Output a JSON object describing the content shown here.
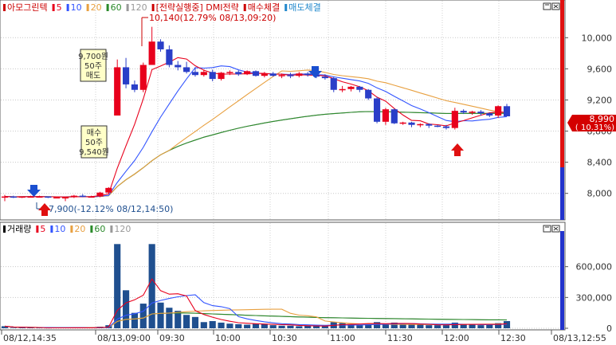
{
  "price_panel": {
    "legend": [
      {
        "text": "아모그린텍",
        "color": "#cc0000"
      },
      {
        "text": "5",
        "color": "#e8001c"
      },
      {
        "text": "10",
        "color": "#3355ff"
      },
      {
        "text": "20",
        "color": "#e8a040"
      },
      {
        "text": "60",
        "color": "#2a8a2a"
      },
      {
        "text": "120",
        "color": "#999999"
      },
      {
        "text": "[전략실행중] DMI전략",
        "color": "#cc0000"
      },
      {
        "text": "매수체결",
        "color": "#cc0000"
      },
      {
        "text": "매도체결",
        "color": "#2288cc"
      }
    ],
    "high_label": "10,140(12.79% 08/13,09:20)",
    "low_label": "7,900(-12.12% 08/12,14:50)",
    "current_price": "8,990",
    "current_change": "( 10.31%)",
    "sell_box": {
      "price": "9,700원",
      "qty": "50주",
      "side": "매도"
    },
    "buy_box": {
      "side": "매수",
      "qty": "50주",
      "price": "9,540원"
    }
  },
  "volume_panel": {
    "legend": [
      {
        "text": "거래량",
        "color": "#000000"
      },
      {
        "text": "5",
        "color": "#e8001c"
      },
      {
        "text": "10",
        "color": "#3355ff"
      },
      {
        "text": "20",
        "color": "#e8a040"
      },
      {
        "text": "60",
        "color": "#2a8a2a"
      },
      {
        "text": "120",
        "color": "#999999"
      }
    ]
  },
  "colors": {
    "up": "#e8001c",
    "down": "#2a3ec8",
    "bar": "#1f4f8f",
    "accent": "#cc0000"
  },
  "chart_data": {
    "type": "candlestick",
    "price_axis": {
      "ticks": [
        8000,
        8400,
        8800,
        9200,
        9600,
        10000
      ],
      "tick_labels": [
        "8,000",
        "8,400",
        "8,800",
        "9,200",
        "9,600",
        "10,000"
      ],
      "range": [
        7700,
        10300
      ]
    },
    "volume_axis": {
      "ticks": [
        0,
        300000,
        600000
      ],
      "tick_labels": [
        "0",
        "300,000",
        "600,000"
      ],
      "range": [
        0,
        900000
      ]
    },
    "x_tick_labels": [
      "08/12,14:35",
      "08/13,09:00",
      "09:30",
      "10:00",
      "10:30",
      "11:00",
      "11:30",
      "12:00",
      "12:30",
      "08/13,12:55"
    ],
    "candles": [
      [
        7960,
        7980,
        7900,
        7960
      ],
      [
        7960,
        7970,
        7940,
        7950
      ],
      [
        7950,
        7960,
        7940,
        7960
      ],
      [
        7960,
        7970,
        7950,
        7960
      ],
      [
        7960,
        7970,
        7950,
        7960
      ],
      [
        7960,
        7960,
        7940,
        7950
      ],
      [
        7950,
        7960,
        7940,
        7950
      ],
      [
        7950,
        7960,
        7900,
        7950
      ],
      [
        7950,
        7980,
        7940,
        7970
      ],
      [
        7970,
        7990,
        7950,
        7960
      ],
      [
        7960,
        7970,
        7950,
        7960
      ],
      [
        7960,
        8020,
        7950,
        8010
      ],
      [
        8010,
        8080,
        8000,
        8070
      ],
      [
        9000,
        9720,
        9000,
        9620
      ],
      [
        9620,
        9740,
        9350,
        9400
      ],
      [
        9400,
        9450,
        9300,
        9330
      ],
      [
        9330,
        9680,
        9300,
        9650
      ],
      [
        9650,
        10140,
        9650,
        9950
      ],
      [
        9950,
        9980,
        9820,
        9850
      ],
      [
        9850,
        9900,
        9620,
        9650
      ],
      [
        9650,
        9700,
        9580,
        9620
      ],
      [
        9620,
        9690,
        9540,
        9560
      ],
      [
        9560,
        9620,
        9500,
        9520
      ],
      [
        9520,
        9590,
        9500,
        9560
      ],
      [
        9560,
        9590,
        9440,
        9470
      ],
      [
        9470,
        9560,
        9450,
        9550
      ],
      [
        9550,
        9580,
        9520,
        9560
      ],
      [
        9560,
        9580,
        9510,
        9530
      ],
      [
        9530,
        9580,
        9520,
        9570
      ],
      [
        9570,
        9580,
        9500,
        9510
      ],
      [
        9510,
        9560,
        9490,
        9540
      ],
      [
        9540,
        9560,
        9500,
        9510
      ],
      [
        9510,
        9540,
        9480,
        9520
      ],
      [
        9520,
        9550,
        9480,
        9510
      ],
      [
        9510,
        9560,
        9490,
        9540
      ],
      [
        9540,
        9560,
        9500,
        9520
      ],
      [
        9520,
        9540,
        9480,
        9500
      ],
      [
        9500,
        9530,
        9460,
        9480
      ],
      [
        9480,
        9500,
        9300,
        9330
      ],
      [
        9330,
        9380,
        9300,
        9340
      ],
      [
        9340,
        9380,
        9310,
        9370
      ],
      [
        9370,
        9380,
        9300,
        9330
      ],
      [
        9330,
        9340,
        9200,
        9220
      ],
      [
        9220,
        9240,
        8900,
        8920
      ],
      [
        8920,
        9100,
        8880,
        9080
      ],
      [
        9080,
        9090,
        8890,
        8900
      ],
      [
        8900,
        8920,
        8880,
        8910
      ],
      [
        8910,
        8920,
        8850,
        8880
      ],
      [
        8880,
        8900,
        8850,
        8890
      ],
      [
        8890,
        8900,
        8840,
        8870
      ],
      [
        8870,
        8880,
        8850,
        8860
      ],
      [
        8860,
        8880,
        8820,
        8840
      ],
      [
        8840,
        9100,
        8820,
        9060
      ],
      [
        9060,
        9080,
        9020,
        9040
      ],
      [
        9040,
        9060,
        9010,
        9050
      ],
      [
        9050,
        9070,
        9000,
        9030
      ],
      [
        9030,
        9040,
        8980,
        9000
      ],
      [
        9000,
        9130,
        8970,
        9120
      ],
      [
        9120,
        9150,
        9050,
        8990
      ]
    ],
    "volume": [
      20000,
      5000,
      5000,
      4000,
      4000,
      3000,
      4000,
      5000,
      6000,
      5000,
      4000,
      15000,
      30000,
      820000,
      370000,
      150000,
      240000,
      820000,
      250000,
      200000,
      170000,
      130000,
      110000,
      60000,
      70000,
      55000,
      45000,
      40000,
      35000,
      45000,
      40000,
      30000,
      25000,
      25000,
      20000,
      25000,
      20000,
      20000,
      60000,
      50000,
      40000,
      35000,
      45000,
      60000,
      40000,
      55000,
      35000,
      40000,
      35000,
      30000,
      30000,
      30000,
      55000,
      40000,
      35000,
      30000,
      35000,
      50000,
      70000
    ]
  }
}
